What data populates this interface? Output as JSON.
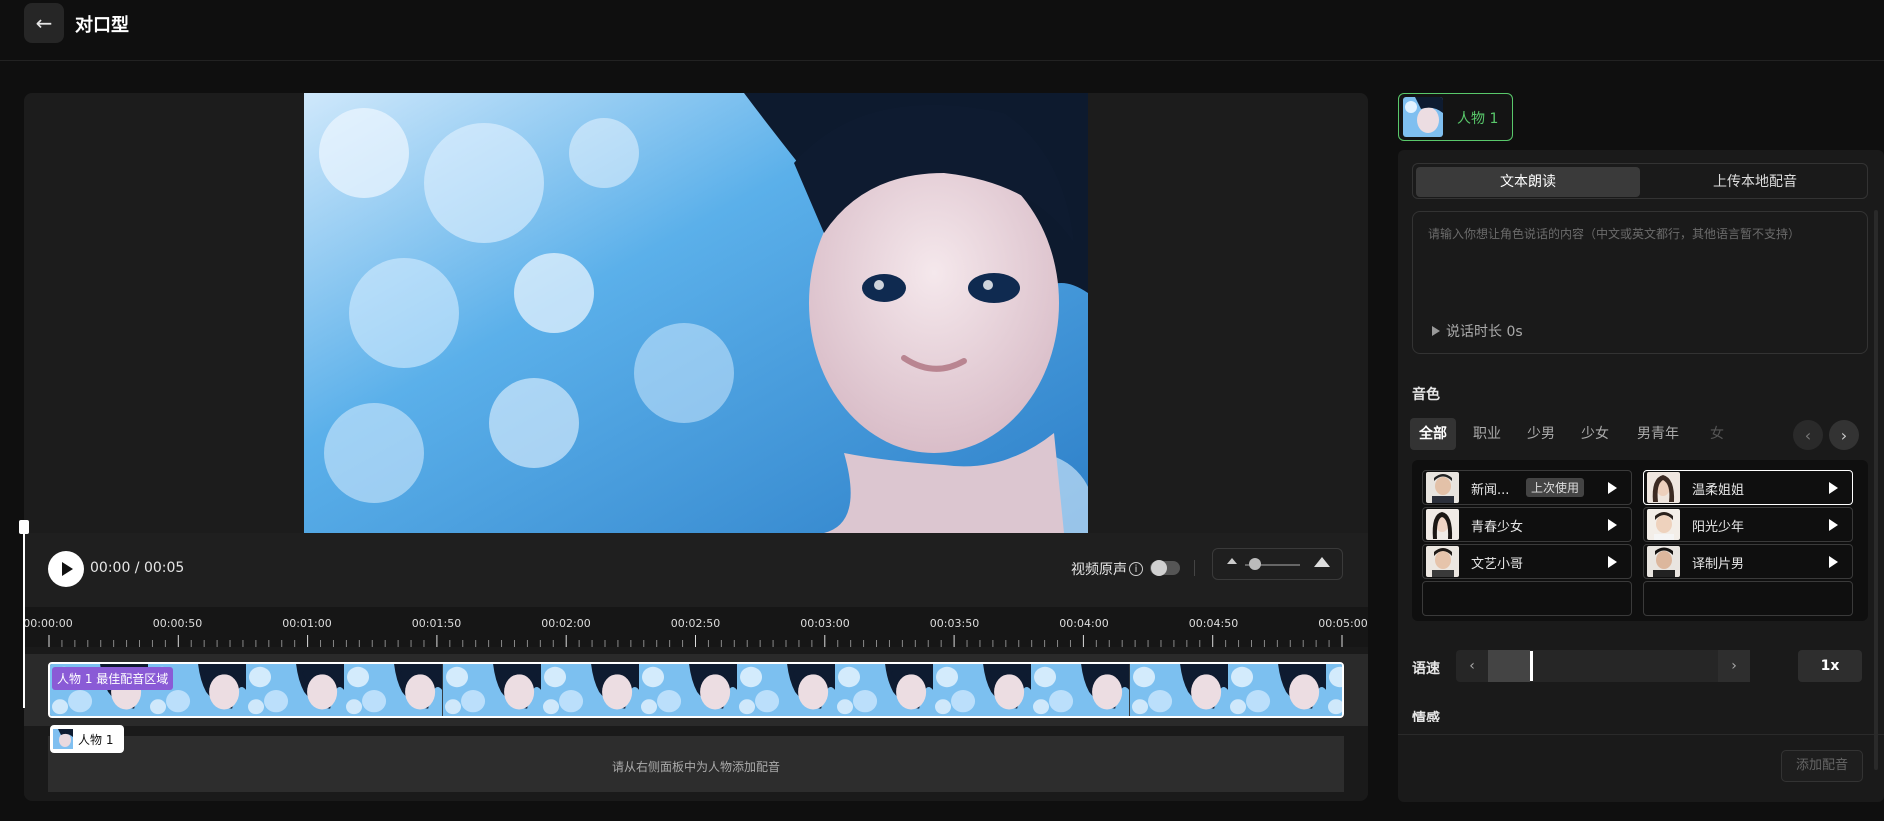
{
  "header": {
    "back_icon": "arrow-left-icon",
    "title": "对口型"
  },
  "player": {
    "time": "00:00 / 00:05",
    "original_sound_label": "视频原声",
    "original_sound_on": false,
    "zoom_level": 0.15
  },
  "timeline": {
    "ticks": [
      "00:00:00",
      "00:00:50",
      "00:01:00",
      "00:01:50",
      "00:02:00",
      "00:02:50",
      "00:03:00",
      "00:03:50",
      "00:04:00",
      "00:04:50",
      "00:05:00"
    ],
    "zone_tag": "人物 1 最佳配音区域",
    "audio_hint": "请从右侧面板中为人物添加配音",
    "person_chip": "人物 1"
  },
  "panel": {
    "character_tab": "人物 1",
    "mode_tabs": [
      "文本朗读",
      "上传本地配音"
    ],
    "text_placeholder": "请输入你想让角色说话的内容（中文或英文都行，其他语言暂不支持）",
    "duration": "说话时长 0s",
    "voice_section": "音色",
    "categories": [
      "全部",
      "职业",
      "少男",
      "少女",
      "男青年",
      "女"
    ],
    "voices": [
      {
        "name": "新闻...",
        "badge": "上次使用"
      },
      {
        "name": "温柔姐姐"
      },
      {
        "name": "青春少女"
      },
      {
        "name": "阳光少年"
      },
      {
        "name": "文艺小哥"
      },
      {
        "name": "译制片男"
      }
    ],
    "speed_label": "语速",
    "speed_value": "1x",
    "emotion_label": "情感",
    "add_button": "添加配音"
  }
}
